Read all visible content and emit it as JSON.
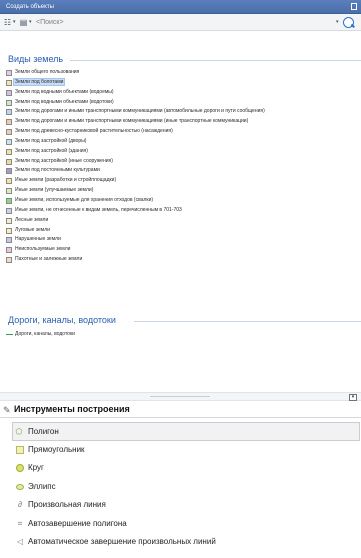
{
  "window": {
    "title": "Создать объекты"
  },
  "toolbar": {
    "template_icon": "layer-template-icon",
    "organize_icon": "organize-templates-icon",
    "search_placeholder": "<Поиск>",
    "search_icon": "search-icon"
  },
  "land_group": {
    "title": "Виды земель",
    "items": [
      {
        "label": "Земли общего пользования",
        "color": "#e7c9ee"
      },
      {
        "label": "Земли под болотами",
        "color": "#f3e6a6",
        "selected": true
      },
      {
        "label": "Земли под водными объектами (водоемы)",
        "color": "#d4bfe6"
      },
      {
        "label": "Земли под водными объектами (водотоки)",
        "color": "#c8ecc8"
      },
      {
        "label": "Земли под дорогами и иными транспортными коммуникациями (автомобильные дороги и пути сообщения)",
        "color": "#bed4f0"
      },
      {
        "label": "Земли под дорогами и иными транспортными коммуникациями (иные транспортные коммуникации)",
        "color": "#f3c9a9"
      },
      {
        "label": "Земли под древесно-кустарниковой растительностью (насаждения)",
        "color": "#e9cdb6"
      },
      {
        "label": "Земли под застройкой (дворы)",
        "color": "#c7e4f3"
      },
      {
        "label": "Земли под застройкой (здания)",
        "color": "#f0e39b"
      },
      {
        "label": "Земли под застройкой (иные сооружения)",
        "color": "#e8dca6"
      },
      {
        "label": "Земли под постоянными культурами",
        "color": "#a99acb"
      },
      {
        "label": "Иные земли (разработки и стройплощадки)",
        "color": "#f6e3a2"
      },
      {
        "label": "Иные земли (улучшаемые земли)",
        "color": "#d9ecbf"
      },
      {
        "label": "Иные земли, используемые для хранения отходов (свалки)",
        "color": "#8bd97f"
      },
      {
        "label": "Иные земли, не отнесенные к видам земель, перечисленным в 701-703",
        "color": "#c5d4f1"
      },
      {
        "label": "Лесные земли",
        "color": "#f2efc6"
      },
      {
        "label": "Луговые земли",
        "color": "#f5efb4"
      },
      {
        "label": "Нарушенные земли",
        "color": "#c9c5ea"
      },
      {
        "label": "Неиспользуемые земли",
        "color": "#f1c5d9"
      },
      {
        "label": "Пахотные и залежные земли",
        "color": "#f4dcc2"
      }
    ]
  },
  "road_group": {
    "title": "Дороги, каналы, водотоки",
    "items": [
      {
        "label": "Дороги, каналы, водотоки",
        "color": "#3a9a5a"
      }
    ]
  },
  "splitter": {
    "toggle_symbol": "▾"
  },
  "tools": {
    "title": "Инструменты построения",
    "header_icon": "construction-tools-icon",
    "items": [
      {
        "label": "Полигон",
        "icon": "polygon-icon",
        "active": true
      },
      {
        "label": "Прямоугольник",
        "icon": "rectangle-icon"
      },
      {
        "label": "Круг",
        "icon": "circle-icon"
      },
      {
        "label": "Эллипс",
        "icon": "ellipse-icon"
      },
      {
        "label": "Произвольная линия",
        "icon": "freehand-icon"
      },
      {
        "label": "Автозавершение полигона",
        "icon": "autocomplete-polygon-icon"
      },
      {
        "label": "Автоматическое завершение произвольных линий",
        "icon": "autocomplete-freehand-icon"
      }
    ]
  }
}
